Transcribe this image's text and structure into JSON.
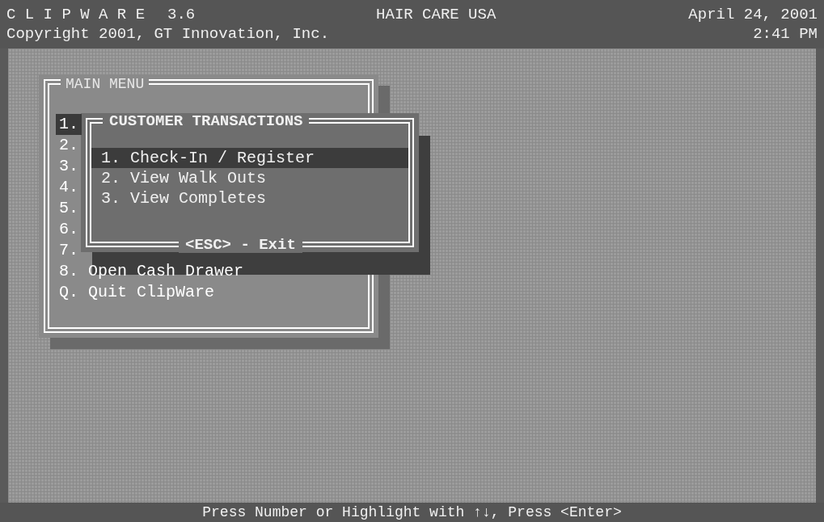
{
  "header": {
    "app_name": "C L I P W A R E",
    "version": "3.6",
    "company": "HAIR CARE USA",
    "date": "April 24, 2001",
    "copyright": "Copyright 2001, GT Innovation, Inc.",
    "time": "2:41 PM"
  },
  "main_menu": {
    "title": "MAIN MENU",
    "items": [
      {
        "key": "1.",
        "selected": true
      },
      {
        "key": "2.",
        "selected": false
      },
      {
        "key": "3.",
        "selected": false
      },
      {
        "key": "4.",
        "selected": false
      },
      {
        "key": "5.",
        "selected": false
      },
      {
        "key": "6.",
        "selected": false
      },
      {
        "key": "7.",
        "selected": false
      },
      {
        "key": "8.",
        "label": "Open Cash Drawer",
        "selected": false
      },
      {
        "key": "Q.",
        "label": "Quit ClipWare",
        "selected": false
      }
    ]
  },
  "popup": {
    "title": "CUSTOMER TRANSACTIONS",
    "items": [
      {
        "text": "1. Check-In / Register",
        "selected": true
      },
      {
        "text": "2. View Walk Outs",
        "selected": false
      },
      {
        "text": "3. View Completes",
        "selected": false
      }
    ],
    "footer": "<ESC> - Exit"
  },
  "status_bar": "Press Number or Highlight with ↑↓, Press <Enter>"
}
